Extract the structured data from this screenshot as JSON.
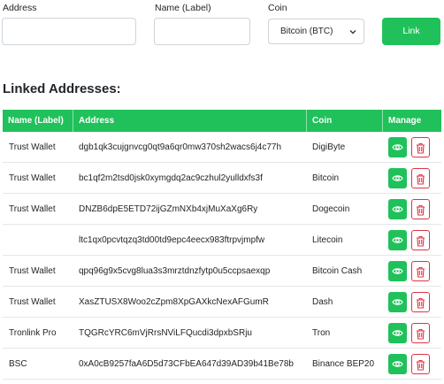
{
  "form": {
    "address_label": "Address",
    "name_label": "Name (Label)",
    "coin_label": "Coin",
    "address_value": "",
    "name_value": "",
    "coin_selected": "Bitcoin (BTC)",
    "link_label": "Link"
  },
  "section_title": "Linked Addresses:",
  "table": {
    "headers": {
      "name": "Name (Label)",
      "address": "Address",
      "coin": "Coin",
      "manage": "Manage"
    },
    "rows": [
      {
        "name": "Trust Wallet",
        "address": "dgb1qk3cujgnvcg0qt9a6qr0mw370sh2wacs6j4c77h",
        "coin": "DigiByte"
      },
      {
        "name": "Trust Wallet",
        "address": "bc1qf2m2tsd0jsk0xymgdq2ac9czhul2yulldxfs3f",
        "coin": "Bitcoin"
      },
      {
        "name": "Trust Wallet",
        "address": "DNZB6dpE5ETD72ijGZmNXb4xjMuXaXg6Ry",
        "coin": "Dogecoin"
      },
      {
        "name": "",
        "address": "ltc1qx0pcvtqzq3td00td9epc4eecx983ftrpvjmpfw",
        "coin": "Litecoin"
      },
      {
        "name": "Trust Wallet",
        "address": "qpq96g9x5cvg8lua3s3mrztdnzfytp0u5ccpsaexqp",
        "coin": "Bitcoin Cash"
      },
      {
        "name": "Trust Wallet",
        "address": "XasZTUSX8Woo2cZpm8XpGAXkcNexAFGumR",
        "coin": "Dash"
      },
      {
        "name": "Tronlink Pro",
        "address": "TQGRcYRC6mVjRrsNViLFQucdi3dpxbSRju",
        "coin": "Tron"
      },
      {
        "name": "BSC",
        "address": "0xA0cB9257faA6D5d73CFbEA647d39AD39b41Be78b",
        "coin": "Binance BEP20"
      }
    ]
  },
  "colors": {
    "accent": "#20c15a",
    "danger": "#dc3545"
  },
  "icons": {
    "view": "eye-icon",
    "delete": "trash-icon",
    "select": "chevron-down-icon"
  }
}
